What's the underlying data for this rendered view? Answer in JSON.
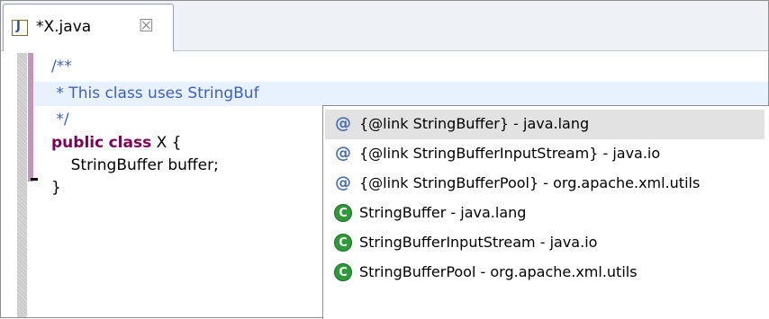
{
  "tab": {
    "title": "*X.java",
    "close_glyph": "☒",
    "file_icon_letter": "J"
  },
  "editor": {
    "lines": [
      "/**",
      " * This class uses StringBuf",
      " */",
      "public class X {",
      "    StringBuffer buffer;",
      "}"
    ],
    "keyword_public": "public",
    "keyword_class": "class",
    "class_decl_rest": " X {"
  },
  "completion": {
    "items": [
      {
        "icon": "at-icon",
        "glyph": "@",
        "label": "{@link StringBuffer} - java.lang",
        "selected": true
      },
      {
        "icon": "at-icon",
        "glyph": "@",
        "label": "{@link StringBufferInputStream} - java.io",
        "selected": false
      },
      {
        "icon": "at-icon",
        "glyph": "@",
        "label": "{@link StringBufferPool} - org.apache.xml.utils",
        "selected": false
      },
      {
        "icon": "class-icon",
        "glyph": "C",
        "label": "StringBuffer - java.lang",
        "selected": false
      },
      {
        "icon": "class-icon",
        "glyph": "C",
        "label": "StringBufferInputStream - java.io",
        "selected": false
      },
      {
        "icon": "class-icon",
        "glyph": "C",
        "label": "StringBufferPool - org.apache.xml.utils",
        "selected": false
      }
    ]
  },
  "colors": {
    "comment": "#3f5fbf",
    "keyword": "#7f0055",
    "current_line": "#e8f2fe",
    "class_icon": "#2e9a3a"
  }
}
